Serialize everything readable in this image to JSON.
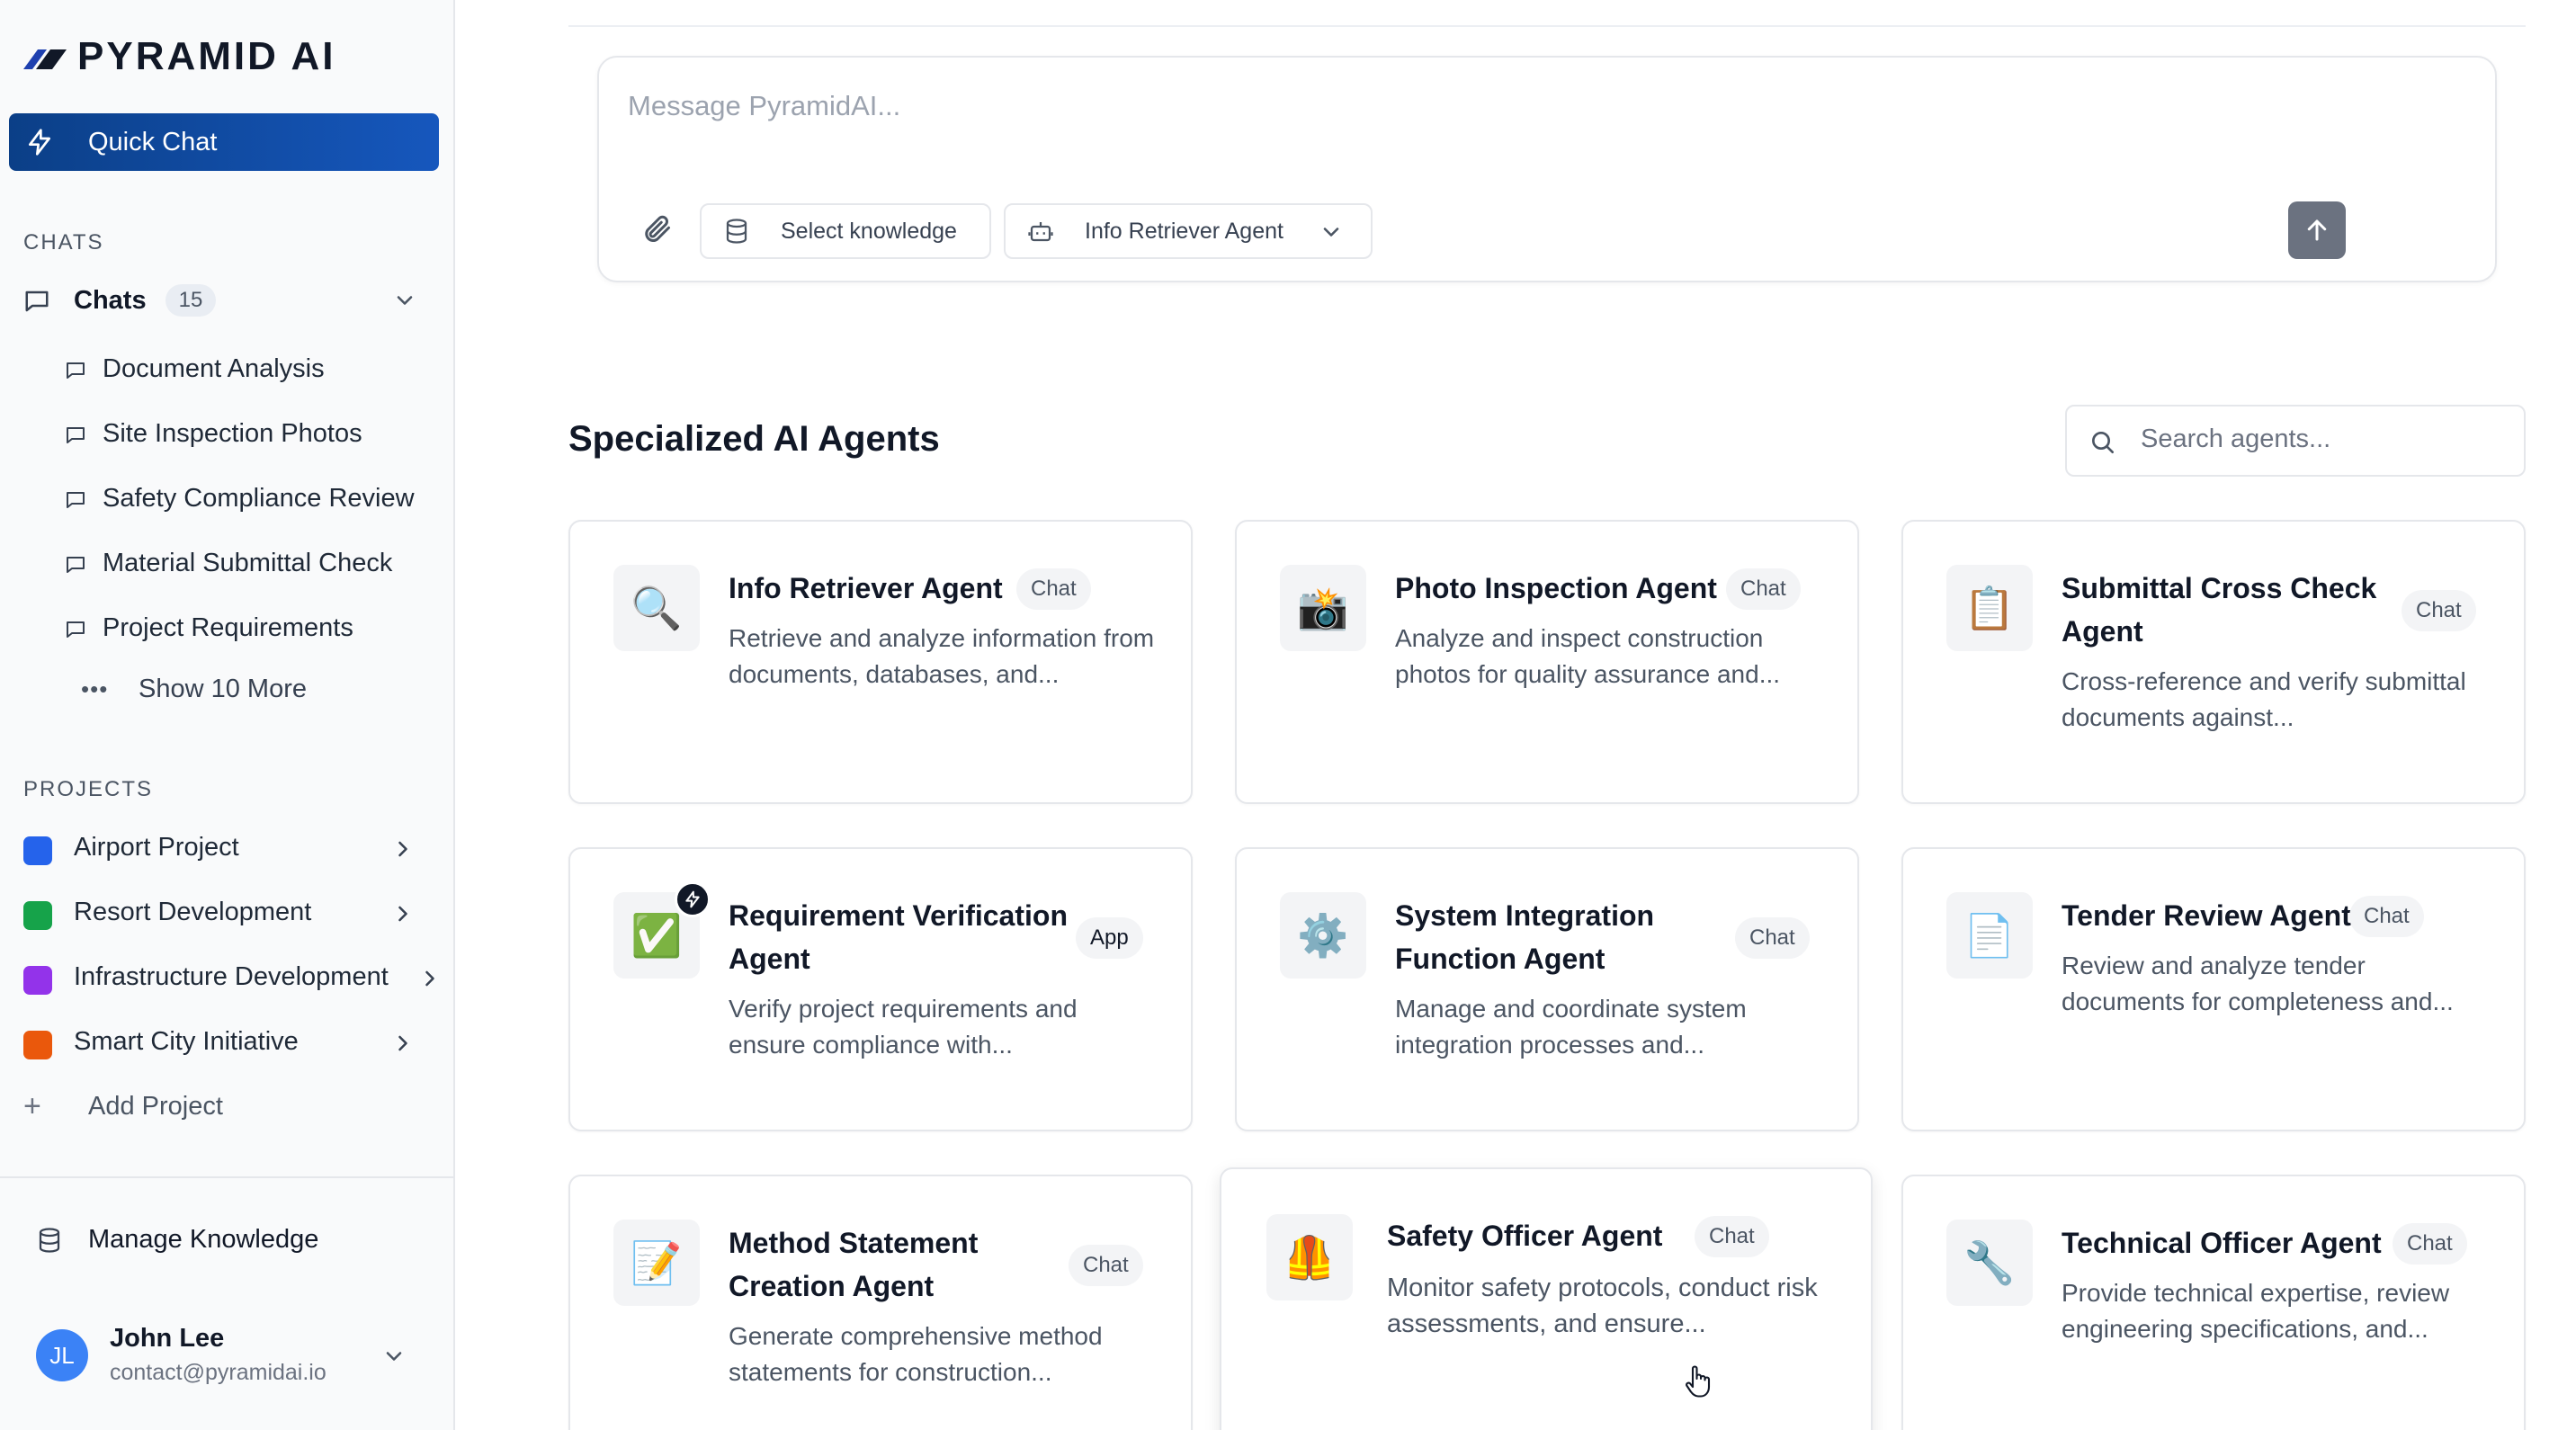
{
  "brand": {
    "name": "PYRAMID AI"
  },
  "sidebar": {
    "quick_chat": "Quick Chat",
    "chats_section": "CHATS",
    "chats_label": "Chats",
    "chats_count": "15",
    "chat_items": [
      "Document Analysis",
      "Site Inspection Photos",
      "Safety Compliance Review",
      "Material Submittal Check",
      "Project Requirements"
    ],
    "show_more": "Show 10 More",
    "projects_section": "PROJECTS",
    "projects": [
      {
        "name": "Airport Project",
        "color": "#2563eb"
      },
      {
        "name": "Resort Development",
        "color": "#16a34a"
      },
      {
        "name": "Infrastructure Development",
        "color": "#9333ea"
      },
      {
        "name": "Smart City Initiative",
        "color": "#ea580c"
      }
    ],
    "add_project": "Add Project",
    "manage_knowledge": "Manage Knowledge",
    "user": {
      "initials": "JL",
      "name": "John Lee",
      "email": "contact@pyramidai.io"
    }
  },
  "composer": {
    "placeholder": "Message PyramidAI...",
    "select_knowledge": "Select knowledge",
    "agent_selected": "Info Retriever Agent"
  },
  "agents_section": {
    "title": "Specialized AI Agents",
    "search_placeholder": "Search agents...",
    "cards": [
      {
        "icon": "🔍",
        "icon_name": "magnifier-icon",
        "title": "Info Retriever Agent",
        "tag": "Chat",
        "desc": "Retrieve and analyze information from documents, databases, and..."
      },
      {
        "icon": "📸",
        "icon_name": "camera-flash-icon",
        "title": "Photo Inspection Agent",
        "tag": "Chat",
        "desc": "Analyze and inspect construction photos for quality assurance and..."
      },
      {
        "icon": "📋",
        "icon_name": "clipboard-icon",
        "title": "Submittal Cross Check Agent",
        "tag": "Chat",
        "desc": "Cross-reference and verify submittal documents against..."
      },
      {
        "icon": "✅",
        "icon_name": "check-mark-icon",
        "title": "Requirement Verification Agent",
        "tag": "App",
        "desc": "Verify project requirements and ensure compliance with..."
      },
      {
        "icon": "⚙️",
        "icon_name": "gear-icon",
        "title": "System Integration Function Agent",
        "tag": "Chat",
        "desc": "Manage and coordinate system integration processes and..."
      },
      {
        "icon": "📄",
        "icon_name": "document-icon",
        "title": "Tender Review Agent",
        "tag": "Chat",
        "desc": "Review and analyze tender documents for completeness and..."
      },
      {
        "icon": "📝",
        "icon_name": "memo-icon",
        "title": "Method Statement Creation Agent",
        "tag": "Chat",
        "desc": "Generate comprehensive method statements for construction..."
      },
      {
        "icon": "🦺",
        "icon_name": "safety-vest-icon",
        "title": "Safety Officer Agent",
        "tag": "Chat",
        "desc": "Monitor safety protocols, conduct risk assessments, and ensure..."
      },
      {
        "icon": "🔧",
        "icon_name": "wrench-icon",
        "title": "Technical Officer Agent",
        "tag": "Chat",
        "desc": "Provide technical expertise, review engineering specifications, and..."
      }
    ]
  },
  "colors": {
    "accent": "#0b3f87",
    "send_button": "#6b7280"
  }
}
